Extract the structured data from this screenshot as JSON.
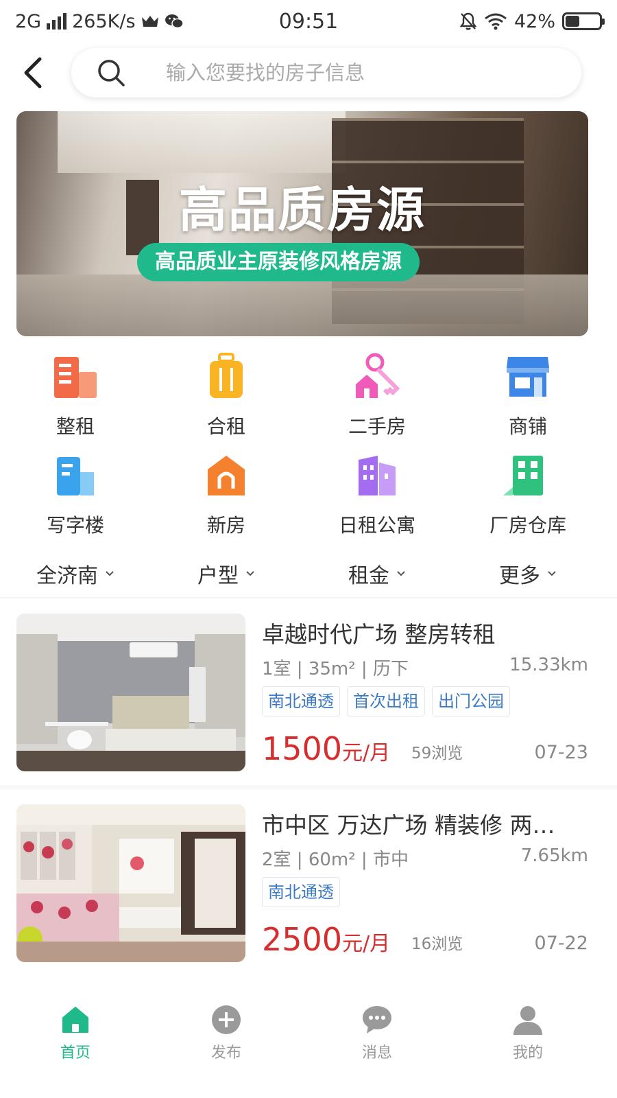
{
  "status_bar": {
    "network": "2G",
    "speed": "265K/s",
    "time": "09:51",
    "battery": "42%",
    "battery_level": 0.42
  },
  "search": {
    "placeholder": "输入您要找的房子信息"
  },
  "banner": {
    "title": "高品质房源",
    "subtitle": "高品质业主原装修风格房源",
    "accent": "#1fb98b"
  },
  "categories": [
    {
      "label": "整租",
      "icon": "building-icon",
      "color": "#f26a46"
    },
    {
      "label": "合租",
      "icon": "suitcase-icon",
      "color": "#f8b423"
    },
    {
      "label": "二手房",
      "icon": "keys-house-icon",
      "color": "#f05ab8"
    },
    {
      "label": "商铺",
      "icon": "store-icon",
      "color": "#3b86e6"
    },
    {
      "label": "写字楼",
      "icon": "office-building-icon",
      "color": "#3aa3ee"
    },
    {
      "label": "新房",
      "icon": "house-icon",
      "color": "#f5802e"
    },
    {
      "label": "日租公寓",
      "icon": "apartment-icon",
      "color": "#a46cf0"
    },
    {
      "label": "厂房仓库",
      "icon": "factory-icon",
      "color": "#2fc27e"
    }
  ],
  "filters": [
    {
      "label": "全济南"
    },
    {
      "label": "户型"
    },
    {
      "label": "租金"
    },
    {
      "label": "更多"
    }
  ],
  "listings": [
    {
      "title": "卓越时代广场 整房转租",
      "meta": "1室 | 35m² | 历下",
      "distance": "15.33km",
      "tags": [
        "南北通透",
        "首次出租",
        "出门公园"
      ],
      "price": "1500",
      "price_unit": "元/月",
      "views": "59浏览",
      "date": "07-23"
    },
    {
      "title": "市中区 万达广场 精装修 两…",
      "meta": "2室 | 60m² | 市中",
      "distance": "7.65km",
      "tags": [
        "南北通透"
      ],
      "price": "2500",
      "price_unit": "元/月",
      "views": "16浏览",
      "date": "07-22"
    }
  ],
  "bottom_nav": [
    {
      "label": "首页",
      "icon": "home-icon",
      "active": true
    },
    {
      "label": "发布",
      "icon": "plus-circle-icon",
      "active": false
    },
    {
      "label": "消息",
      "icon": "chat-bubble-icon",
      "active": false
    },
    {
      "label": "我的",
      "icon": "user-icon",
      "active": false
    }
  ],
  "colors": {
    "primary": "#1fb98b",
    "price": "#d62e2e",
    "tag_text": "#3c7bc4"
  }
}
